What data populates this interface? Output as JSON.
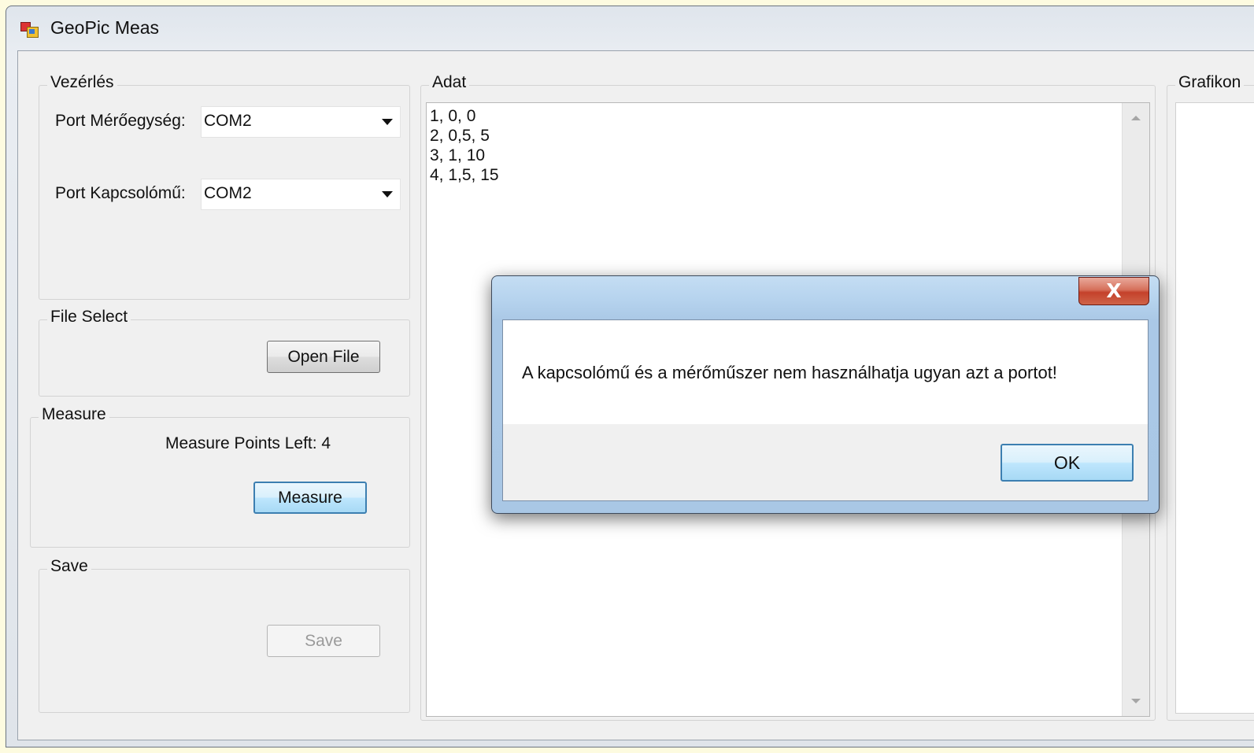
{
  "window": {
    "title": "GeoPic Meas",
    "icon": "app-icon"
  },
  "control_group": {
    "label": "Vezérlés",
    "port_meter_label": "Port Mérőegység:",
    "port_meter_value": "COM2",
    "port_switch_label": "Port Kapcsolómű:",
    "port_switch_value": "COM2"
  },
  "file_group": {
    "label": "File Select",
    "open_button": "Open File"
  },
  "measure_group": {
    "label": "Measure",
    "points_left": "Measure Points Left: 4",
    "measure_button": "Measure"
  },
  "save_group": {
    "label": "Save",
    "save_button": "Save"
  },
  "data_group": {
    "label": "Adat",
    "lines": [
      "1, 0, 0",
      "2, 0,5, 5",
      "3, 1, 10",
      "4, 1,5, 15"
    ]
  },
  "chart_group": {
    "label": "Grafikon"
  },
  "dialog": {
    "close_glyph": "X",
    "message": "A kapcsolómű és a mérőműszer nem használhatja ugyan azt a portot!",
    "ok_button": "OK"
  },
  "colors": {
    "accent": "#3c7fb1",
    "close_red": "#c4412b",
    "background": "#f0f0f0"
  }
}
